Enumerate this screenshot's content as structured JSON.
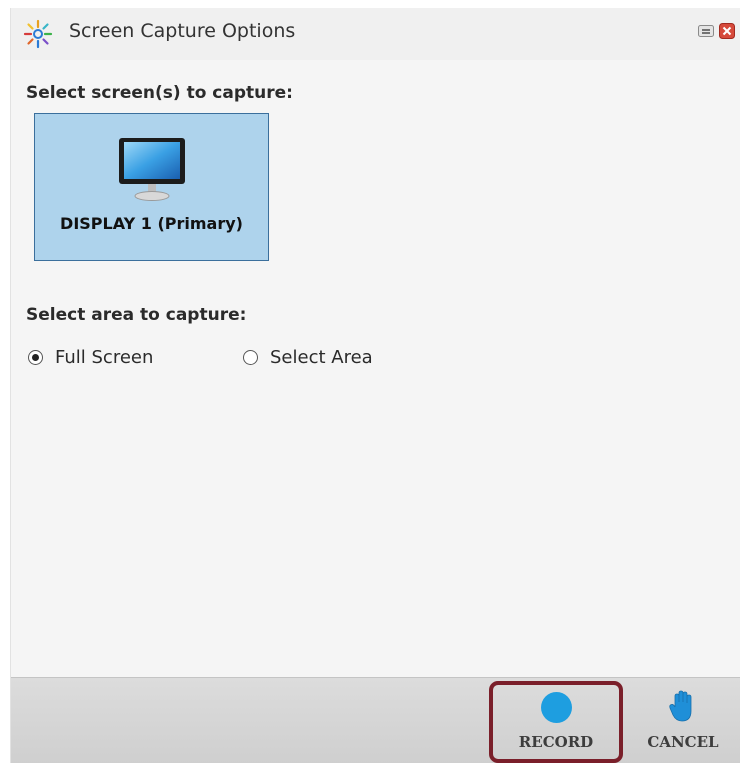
{
  "window": {
    "title": "Screen Capture Options",
    "app_icon": "burst-logo-icon"
  },
  "screens": {
    "label": "Select screen(s) to capture:",
    "displays": [
      {
        "label": "DISPLAY 1 (Primary)",
        "selected": true,
        "icon": "monitor-icon"
      }
    ]
  },
  "area": {
    "label": "Select area to capture:",
    "options": [
      {
        "label": "Full Screen",
        "checked": true
      },
      {
        "label": "Select Area",
        "checked": false
      }
    ]
  },
  "footer": {
    "record_label": "RECORD",
    "cancel_label": "CANCEL"
  },
  "colors": {
    "tile_bg": "#aed3ec",
    "tile_border": "#3b6f9c",
    "record_accent": "#1e9ee0",
    "highlight": "#7a1f2a",
    "close_red": "#d64a3b"
  }
}
